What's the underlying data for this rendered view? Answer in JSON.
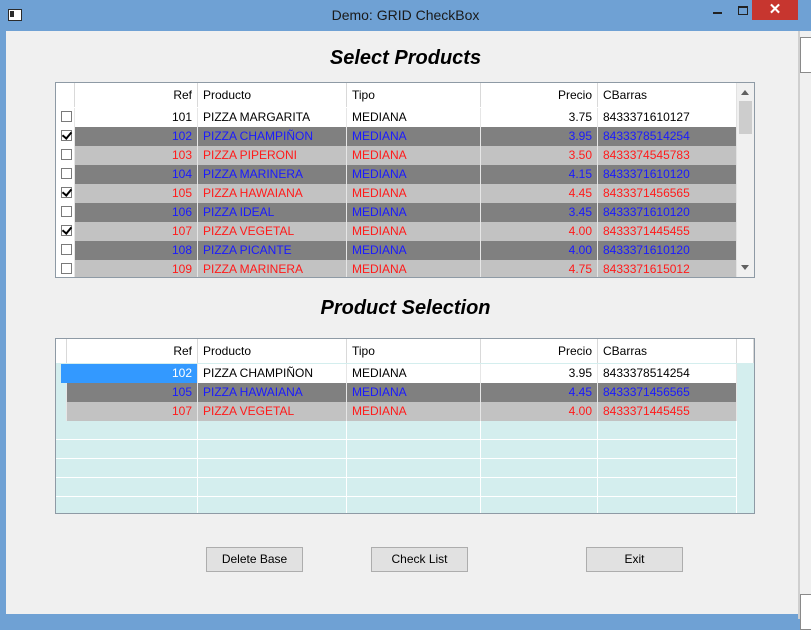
{
  "window": {
    "title": "Demo: GRID CheckBox"
  },
  "titlebar": {
    "close_glyph": "✕",
    "icons": [
      "app-icon",
      "minimize-icon",
      "maximize-icon",
      "close-icon"
    ]
  },
  "headings": {
    "select": "Select Products",
    "selection": "Product Selection"
  },
  "columns": [
    "Ref",
    "Producto",
    "Tipo",
    "Precio",
    "CBarras"
  ],
  "colors": {
    "black": "#000000",
    "blue": "#1a1aff",
    "red": "#ff1a1a",
    "row_light": "#c2c2c2",
    "row_dark": "#808080",
    "row_white": "#ffffff",
    "selected": "#3399ff",
    "empty_fill": "#d4eeee"
  },
  "products": [
    {
      "ref": "101",
      "producto": "PIZZA MARGARITA",
      "tipo": "MEDIANA",
      "precio": "3.75",
      "cbarras": "8433371610127",
      "checked": false
    },
    {
      "ref": "102",
      "producto": "PIZZA CHAMPIÑON",
      "tipo": "MEDIANA",
      "precio": "3.95",
      "cbarras": "8433378514254",
      "checked": true
    },
    {
      "ref": "103",
      "producto": "PIZZA PIPERONI",
      "tipo": "MEDIANA",
      "precio": "3.50",
      "cbarras": "8433374545783",
      "checked": false
    },
    {
      "ref": "104",
      "producto": "PIZZA MARINERA",
      "tipo": "MEDIANA",
      "precio": "4.15",
      "cbarras": "8433371610120",
      "checked": false
    },
    {
      "ref": "105",
      "producto": "PIZZA HAWAIANA",
      "tipo": "MEDIANA",
      "precio": "4.45",
      "cbarras": "8433371456565",
      "checked": true
    },
    {
      "ref": "106",
      "producto": "PIZZA IDEAL",
      "tipo": "MEDIANA",
      "precio": "3.45",
      "cbarras": "8433371610120",
      "checked": false
    },
    {
      "ref": "107",
      "producto": "PIZZA VEGETAL",
      "tipo": "MEDIANA",
      "precio": "4.00",
      "cbarras": "8433371445455",
      "checked": true
    },
    {
      "ref": "108",
      "producto": "PIZZA PICANTE",
      "tipo": "MEDIANA",
      "precio": "4.00",
      "cbarras": "8433371610120",
      "checked": false
    },
    {
      "ref": "109",
      "producto": "PIZZA MARINERA",
      "tipo": "MEDIANA",
      "precio": "4.75",
      "cbarras": "8433371615012",
      "checked": false
    }
  ],
  "selection": [
    {
      "ref": "102",
      "producto": "PIZZA CHAMPIÑON",
      "tipo": "MEDIANA",
      "precio": "3.95",
      "cbarras": "8433378514254"
    },
    {
      "ref": "105",
      "producto": "PIZZA HAWAIANA",
      "tipo": "MEDIANA",
      "precio": "4.45",
      "cbarras": "8433371456565"
    },
    {
      "ref": "107",
      "producto": "PIZZA VEGETAL",
      "tipo": "MEDIANA",
      "precio": "4.00",
      "cbarras": "8433371445455"
    }
  ],
  "buttons": {
    "delete": "Delete Base",
    "check": "Check List",
    "exit": "Exit"
  }
}
